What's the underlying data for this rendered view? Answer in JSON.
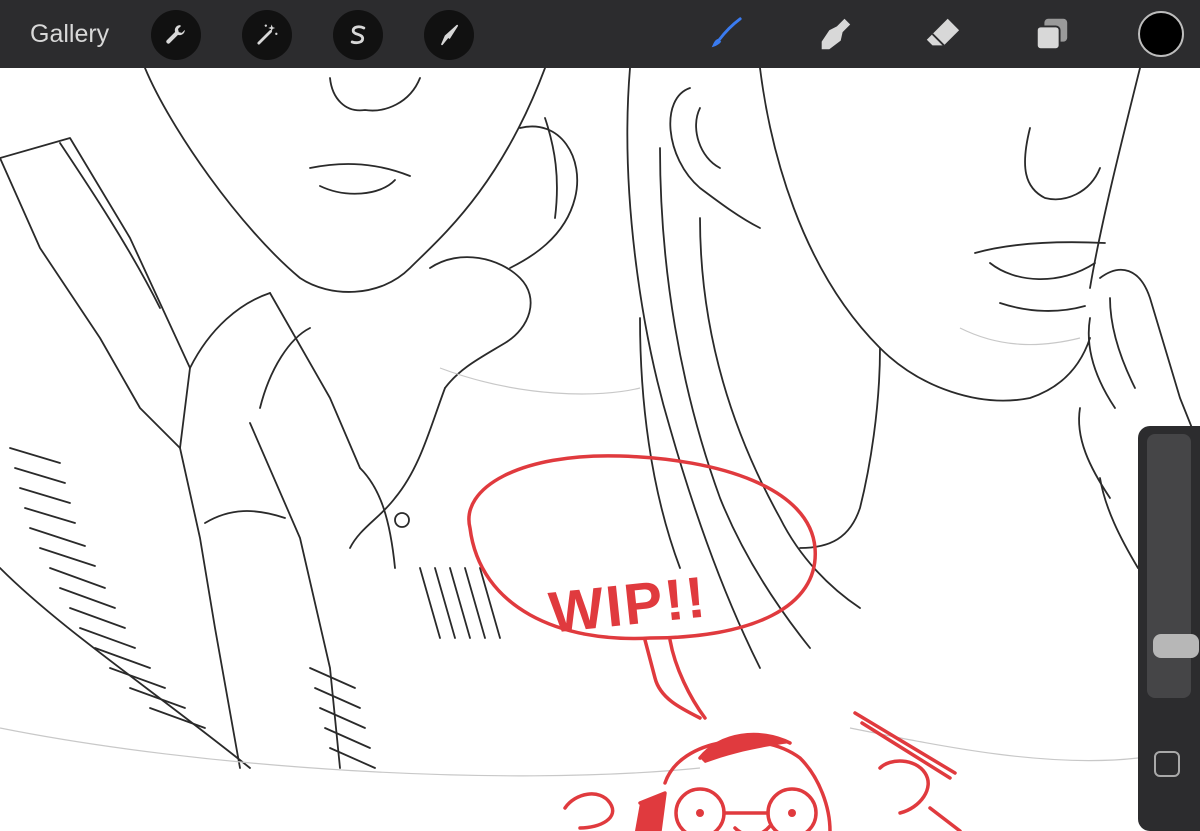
{
  "toolbar": {
    "gallery_label": "Gallery",
    "left_tools": [
      {
        "name": "actions",
        "icon": "wrench-icon"
      },
      {
        "name": "adjustments",
        "icon": "magic-wand-icon"
      },
      {
        "name": "selection",
        "icon": "selection-icon"
      },
      {
        "name": "transform",
        "icon": "cursor-arrow-icon"
      }
    ],
    "right_tools": [
      {
        "name": "brush",
        "icon": "brush-icon",
        "active": true
      },
      {
        "name": "smudge",
        "icon": "smudge-icon",
        "active": false
      },
      {
        "name": "eraser",
        "icon": "eraser-icon",
        "active": false
      },
      {
        "name": "layers",
        "icon": "layers-icon",
        "active": false
      }
    ],
    "current_color": "#000000",
    "active_color": "#3a7bf0"
  },
  "canvas": {
    "annotation_text": "WIP!!",
    "annotation_color": "#e03a3e",
    "line_art_color": "#2a2a2a"
  },
  "side_panel": {
    "brush_size_level": 0.16,
    "modify_button_icon": "square-icon"
  }
}
